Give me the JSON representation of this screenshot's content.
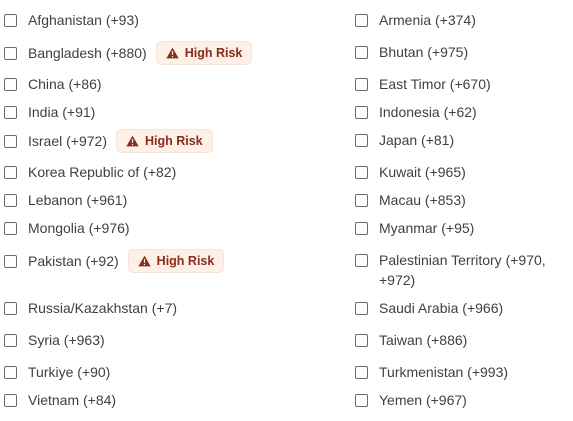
{
  "countries": {
    "left": [
      {
        "label": "Afghanistan (+93)",
        "checked": false
      },
      {
        "label": "Bangladesh (+880)",
        "checked": false,
        "badge": "High Risk"
      },
      {
        "label": "China (+86)",
        "checked": false
      },
      {
        "label": "India (+91)",
        "checked": false
      },
      {
        "label": "Israel (+972)",
        "checked": false,
        "badge": "High Risk"
      },
      {
        "label": "Korea Republic of (+82)",
        "checked": false
      },
      {
        "label": "Lebanon (+961)",
        "checked": false
      },
      {
        "label": "Mongolia (+976)",
        "checked": false
      },
      {
        "label": "Pakistan (+92)",
        "checked": false,
        "badge": "High Risk"
      },
      {
        "label": "Russia/Kazakhstan (+7)",
        "checked": false
      },
      {
        "label": "Syria (+963)",
        "checked": false
      },
      {
        "label": "Turkiye (+90)",
        "checked": false
      },
      {
        "label": "Vietnam (+84)",
        "checked": false
      }
    ],
    "right": [
      {
        "label": "Armenia (+374)",
        "checked": false
      },
      {
        "label": "Bhutan (+975)",
        "checked": false
      },
      {
        "label": "East Timor (+670)",
        "checked": false
      },
      {
        "label": "Indonesia (+62)",
        "checked": false
      },
      {
        "label": "Japan (+81)",
        "checked": false
      },
      {
        "label": "Kuwait (+965)",
        "checked": false
      },
      {
        "label": "Macau (+853)",
        "checked": false
      },
      {
        "label": "Myanmar (+95)",
        "checked": false
      },
      {
        "label": "Palestinian Territory (+970, +972)",
        "checked": false
      },
      {
        "label": "Saudi Arabia (+966)",
        "checked": false
      },
      {
        "label": "Taiwan (+886)",
        "checked": false
      },
      {
        "label": "Turkmenistan (+993)",
        "checked": false
      },
      {
        "label": "Yemen (+967)",
        "checked": false
      }
    ]
  },
  "badge": {
    "icon": "warning-triangle-icon",
    "background": "#fdf1e7",
    "text_color": "#8a2c1c"
  }
}
